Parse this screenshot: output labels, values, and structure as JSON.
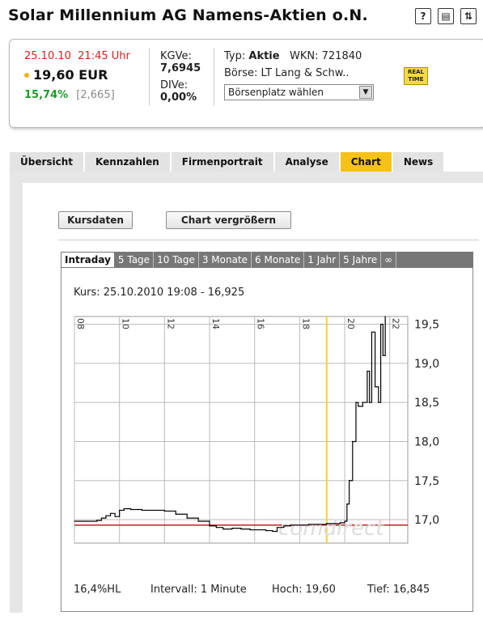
{
  "page": {
    "title": "Solar Millennium AG Namens-Aktien o.N."
  },
  "icons": [
    "help-icon",
    "print-icon",
    "swap-icon"
  ],
  "quote": {
    "date": "25.10.10",
    "time": "21:45 Uhr",
    "price": "19,60 EUR",
    "change_pct": "15,74%",
    "change_abs": "[2,665]",
    "kgve_label": "KGVe:",
    "kgve_value": "7,6945",
    "dive_label": "DIVe:",
    "dive_value": "0,00%",
    "typ_label": "Typ:",
    "typ_value": "Aktie",
    "wkn_label": "WKN:",
    "wkn_value": "721840",
    "boerse": "Börse: LT Lang & Schw..",
    "boersenplatz_select": "Börsenplatz wählen",
    "realtime_badge": [
      "REAL",
      "TIME"
    ],
    "accent_color": "#f6c218"
  },
  "tabs": [
    "Übersicht",
    "Kennzahlen",
    "Firmenportrait",
    "Analyse",
    "Chart",
    "News"
  ],
  "active_tab": "Chart",
  "buttons": {
    "kursdaten": "Kursdaten",
    "vergroessern": "Chart vergrößern"
  },
  "chart_tabs": [
    "Intraday",
    "5 Tage",
    "10 Tage",
    "3 Monate",
    "6 Monate",
    "1 Jahr",
    "5 Jahre",
    "∞"
  ],
  "chart_active_tab": "Intraday",
  "chart_info": {
    "kurs": "Kurs: 25.10.2010 19:08 - 16,925",
    "hl": "16,4%HL",
    "intervall": "Intervall: 1 Minute",
    "hoch": "Hoch:  19,60",
    "tief": "Tief:  16,845",
    "watermark": "comdirect"
  },
  "chart_data": {
    "type": "line",
    "x_ticks": [
      "08",
      "10",
      "12",
      "14",
      "16",
      "18",
      "20",
      "22"
    ],
    "y_ticks": [
      "19,5",
      "19,0",
      "18,5",
      "18,0",
      "17,5",
      "17,0"
    ],
    "ylim": [
      16.7,
      19.6
    ],
    "xlim": [
      8,
      22.8
    ],
    "reference_line": 16.93,
    "marker_time": 19.2,
    "series": [
      {
        "color": "#000000",
        "x": [
          8.0,
          8.5,
          9.0,
          9.2,
          9.4,
          9.6,
          9.8,
          10.0,
          10.2,
          10.5,
          11.0,
          11.5,
          12.0,
          12.5,
          13.0,
          13.5,
          14.0,
          14.3,
          14.6,
          15.0,
          15.4,
          15.8,
          16.2,
          16.5,
          16.8,
          17.0,
          17.3,
          17.6,
          18.0,
          18.4,
          18.8,
          19.2,
          19.5,
          19.8,
          20.0,
          20.1,
          20.2,
          20.35,
          20.5,
          20.6,
          20.8,
          21.0,
          21.1,
          21.2,
          21.35,
          21.5,
          21.6,
          21.7,
          21.8
        ],
        "y": [
          16.98,
          16.98,
          16.99,
          17.02,
          17.05,
          17.08,
          17.04,
          17.12,
          17.14,
          17.13,
          17.12,
          17.12,
          17.11,
          17.07,
          17.02,
          16.98,
          16.92,
          16.9,
          16.88,
          16.89,
          16.88,
          16.87,
          16.87,
          16.86,
          16.85,
          16.9,
          16.92,
          16.93,
          16.93,
          16.94,
          16.94,
          16.95,
          16.95,
          16.96,
          16.98,
          17.2,
          17.5,
          18.0,
          18.5,
          18.45,
          18.5,
          18.9,
          18.5,
          19.4,
          18.7,
          18.5,
          19.5,
          19.1,
          19.6
        ]
      }
    ]
  }
}
